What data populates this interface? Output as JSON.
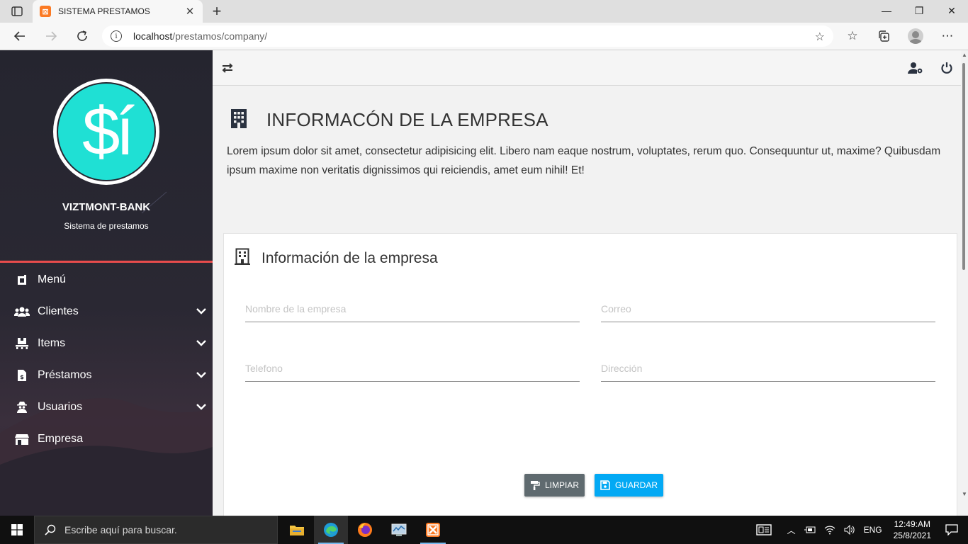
{
  "browser": {
    "tab_title": "SISTEMA PRESTAMOS",
    "address_host": "localhost",
    "address_path": "/prestamos/company/"
  },
  "sidebar": {
    "brand_name": "VIZTMONT-BANK",
    "brand_subtitle": "Sistema de prestamos",
    "logo_text": "$í",
    "items": [
      {
        "label": "Menú",
        "icon": "dashboard-icon",
        "has_submenu": false
      },
      {
        "label": "Clientes",
        "icon": "users-icon",
        "has_submenu": true
      },
      {
        "label": "Items",
        "icon": "pallet-icon",
        "has_submenu": true
      },
      {
        "label": "Préstamos",
        "icon": "invoice-dollar-icon",
        "has_submenu": true
      },
      {
        "label": "Usuarios",
        "icon": "user-secret-icon",
        "has_submenu": true
      },
      {
        "label": "Empresa",
        "icon": "store-icon",
        "has_submenu": false
      }
    ]
  },
  "main": {
    "page_title": "INFORMACÓN DE LA EMPRESA",
    "page_description": "Lorem ipsum dolor sit amet, consectetur adipisicing elit. Libero nam eaque nostrum, voluptates, rerum quo. Consequuntur ut, maxime? Quibusdam ipsum maxime non veritatis dignissimos qui reiciendis, amet eum nihil! Et!",
    "card_title": "Información de la empresa",
    "fields": {
      "company_name_placeholder": "Nombre de la empresa",
      "email_placeholder": "Correo",
      "phone_placeholder": "Telefono",
      "address_placeholder": "Dirección"
    },
    "buttons": {
      "clear": "LIMPIAR",
      "save": "GUARDAR"
    }
  },
  "taskbar": {
    "search_placeholder": "Escribe aquí para buscar.",
    "language": "ENG",
    "time": "12:49:AM",
    "date": "25/8/2021"
  },
  "colors": {
    "sidebar_bg": "#262630",
    "logo_accent": "#1fe0d4",
    "divider_red": "#e84c4c",
    "clear_button": "#5f6a6f",
    "save_button": "#03a9f4"
  }
}
